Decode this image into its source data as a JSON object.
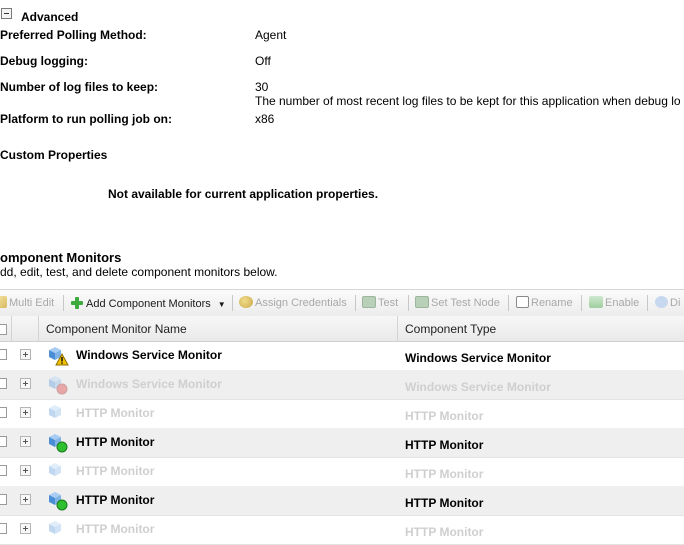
{
  "advanced": {
    "heading": "Advanced",
    "fields": [
      {
        "label": "Preferred Polling Method:",
        "value": "Agent"
      },
      {
        "label": "Debug logging:",
        "value": "Off"
      },
      {
        "label": "Number of log files to keep:",
        "value": "30",
        "note": "The number of most recent log files to be kept for this application when debug lo"
      },
      {
        "label": "Platform to run polling job on:",
        "value": "x86"
      }
    ]
  },
  "custom_properties": {
    "heading": "Custom Properties",
    "message": "Not available for current application properties."
  },
  "component_monitors": {
    "title": "omponent Monitors",
    "subtitle": "dd, edit, test, and delete component monitors below."
  },
  "toolbar": {
    "multi_edit": "Multi Edit",
    "add_component_monitors": "Add Component Monitors",
    "assign_credentials": "Assign Credentials",
    "test": "Test",
    "set_test_node": "Set Test Node",
    "rename": "Rename",
    "enable": "Enable",
    "disable": "Di"
  },
  "grid": {
    "columns": [
      "Component Monitor Name",
      "Component Type"
    ],
    "rows": [
      {
        "name": "Windows Service Monitor",
        "type": "Windows Service Monitor",
        "status": "warning",
        "enabled": true
      },
      {
        "name": "Windows Service Monitor",
        "type": "Windows Service Monitor",
        "status": "down",
        "enabled": false
      },
      {
        "name": "HTTP Monitor",
        "type": "HTTP Monitor",
        "status": "unknown",
        "enabled": false
      },
      {
        "name": "HTTP Monitor",
        "type": "HTTP Monitor",
        "status": "up",
        "enabled": true
      },
      {
        "name": "HTTP Monitor",
        "type": "HTTP Monitor",
        "status": "unknown",
        "enabled": false
      },
      {
        "name": "HTTP Monitor",
        "type": "HTTP Monitor",
        "status": "up",
        "enabled": true
      },
      {
        "name": "HTTP Monitor",
        "type": "HTTP Monitor",
        "status": "unknown",
        "enabled": false
      }
    ]
  },
  "colors": {
    "status_up": "#2fbf2f",
    "status_down": "#e02020",
    "status_warning": "#f2c200",
    "monitor_icon": "#4a8fd6"
  }
}
